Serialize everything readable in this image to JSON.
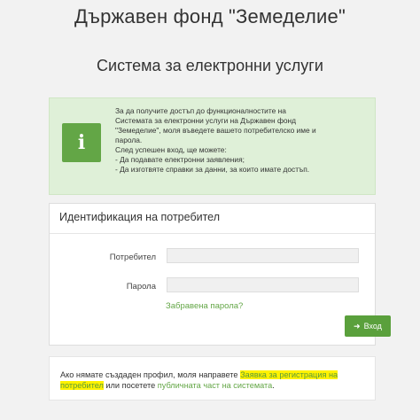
{
  "header": {
    "title": "Държавен фонд \"Земеделие\"",
    "subtitle": "Система за електронни услуги"
  },
  "info": {
    "icon": "info-icon",
    "lines": [
      "За да получите достъп до функционалностите на",
      "Системата за електронни услуги на Държавен фонд",
      "\"Земеделие\", моля въведете вашето потребителско име и",
      "парола.",
      "След успешен вход, ще можете:",
      "- Да подавате електронни заявления;",
      "- Да изготвяте справки за данни, за които имате достъп."
    ]
  },
  "login": {
    "heading": "Идентификация на потребител",
    "username_label": "Потребител",
    "username_value": "",
    "password_label": "Парола",
    "password_value": "",
    "forgot_label": "Забравена парола?",
    "submit_label": "Вход",
    "submit_icon": "sign-in-icon"
  },
  "registration": {
    "text_before": "Ако нямате създаден профил, моля направете ",
    "link1_line1": "Заявка за регистрация на",
    "link1_line2": "потребител",
    "text_middle": " или посетете ",
    "link2": "публичната част на системата",
    "text_end": "."
  },
  "colors": {
    "accent": "#63a646",
    "info_bg": "#dff0d8",
    "highlight": "#fff200"
  }
}
